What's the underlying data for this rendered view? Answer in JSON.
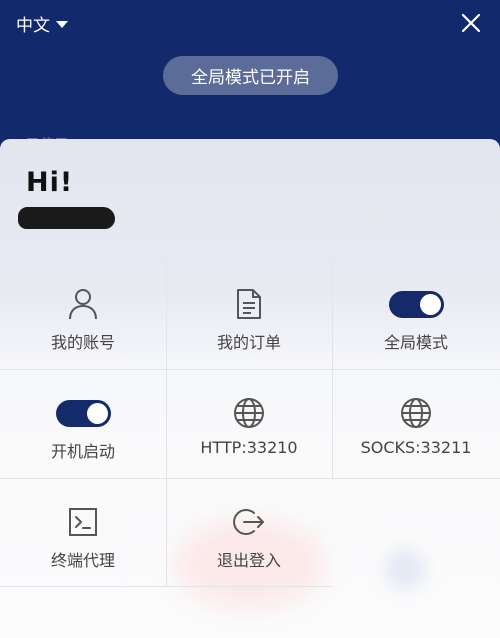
{
  "header": {
    "language": "中文",
    "status_pill": "全局模式已开启",
    "background_text": "已使用"
  },
  "panel": {
    "greeting": "Hi!"
  },
  "grid": {
    "account": "我的账号",
    "orders": "我的订单",
    "global_mode": "全局模式",
    "global_mode_on": true,
    "autostart": "开机启动",
    "autostart_on": true,
    "http": "HTTP:33210",
    "socks": "SOCKS:33211",
    "terminal_proxy": "终端代理",
    "logout": "退出登入"
  },
  "colors": {
    "header_bg": "#122a6c",
    "toggle_on": "#142a6b",
    "pill_bg": "#5b6c98"
  }
}
